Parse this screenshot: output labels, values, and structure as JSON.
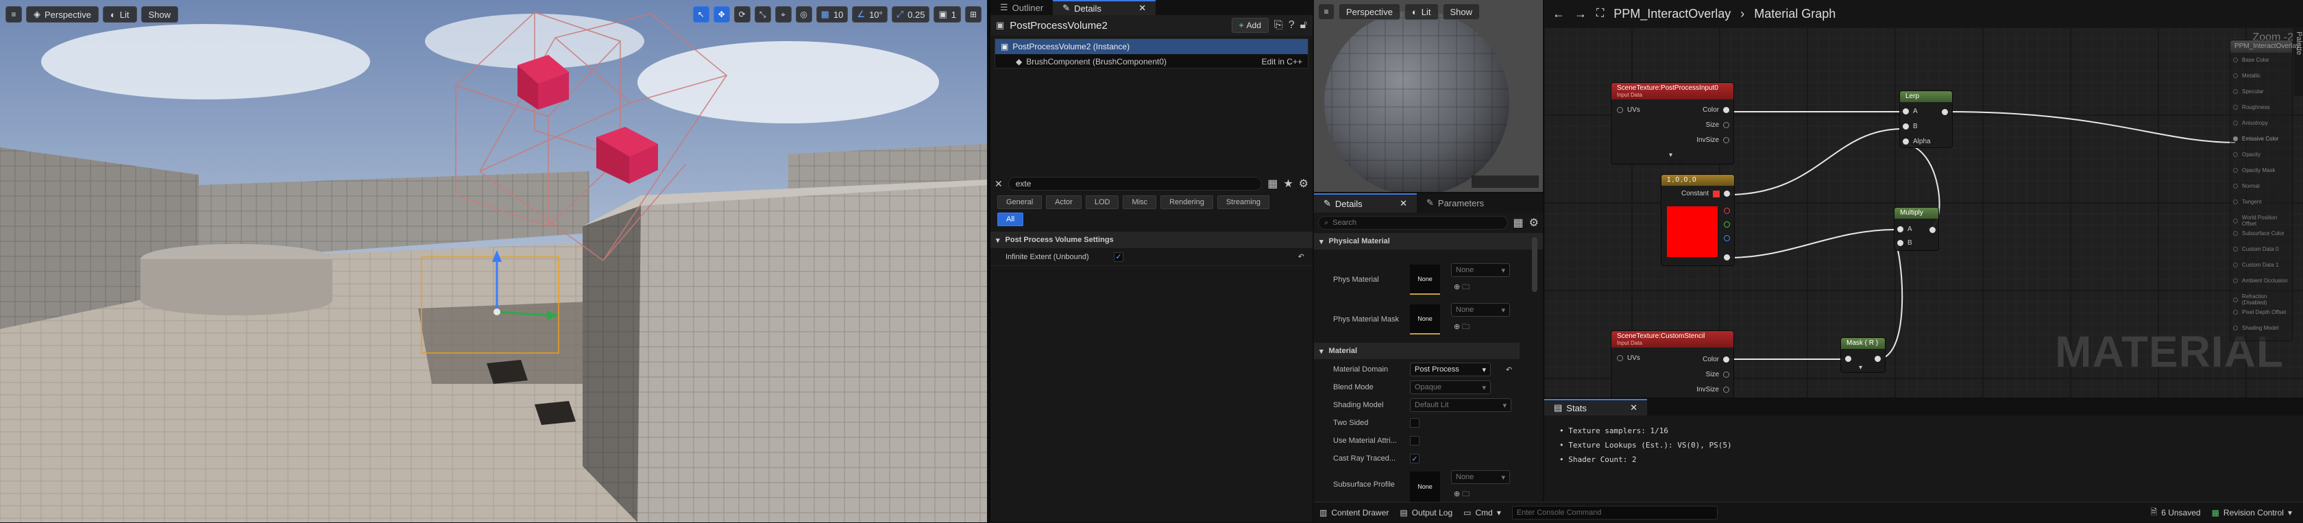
{
  "viewport": {
    "perspective_label": "Perspective",
    "lit_label": "Lit",
    "show_label": "Show",
    "grid_snap_value": "10",
    "rotation_snap_value": "10°",
    "scale_snap_value": "0.25",
    "camera_speed_value": "1"
  },
  "outliner": {
    "tab_outliner": "Outliner",
    "tab_details": "Details",
    "actor_name": "PostProcessVolume2",
    "add_label": "Add",
    "tree": [
      {
        "label": "PostProcessVolume2 (Instance)"
      },
      {
        "label": "BrushComponent (BrushComponent0)",
        "action": "Edit in C++"
      }
    ],
    "search_value": "exte",
    "category_tabs": [
      "General",
      "Actor",
      "LOD",
      "Misc",
      "Rendering",
      "Streaming"
    ],
    "all_tab": "All",
    "section_title": "Post Process Volume Settings",
    "property_label": "Infinite Extent (Unbound)",
    "property_checked": "✓"
  },
  "preview": {
    "perspective_label": "Perspective",
    "lit_label": "Lit",
    "show_label": "Show"
  },
  "mat_details": {
    "tab_details": "Details",
    "tab_parameters": "Parameters",
    "search_placeholder": "Search",
    "section_physical": "Physical Material",
    "phys_material_label": "Phys Material",
    "phys_material_mask_label": "Phys Material Mask",
    "none_label": "None",
    "section_material": "Material",
    "material_domain_label": "Material Domain",
    "material_domain_value": "Post Process",
    "blend_mode_label": "Blend Mode",
    "blend_mode_value": "Opaque",
    "shading_model_label": "Shading Model",
    "shading_model_value": "Default Lit",
    "two_sided_label": "Two Sided",
    "use_material_attr_label": "Use Material Attri...",
    "cast_ray_label": "Cast Ray Traced...",
    "cast_ray_checked": "✓",
    "subsurface_label": "Subsurface Profile"
  },
  "graph": {
    "breadcrumb_asset": "PPM_InteractOverlay",
    "breadcrumb_sep": "›",
    "breadcrumb_graph": "Material Graph",
    "zoom_label": "Zoom -2",
    "palette_label": "Palette",
    "watermark": "MATERIAL",
    "nodes": {
      "scene_texture_1": {
        "title": "SceneTexture:PostProcessInput0",
        "subtitle": "Input Data",
        "pin_uvs": "UVs",
        "pin_color": "Color",
        "pin_size": "Size",
        "pin_invsize": "InvSize"
      },
      "constant": {
        "title": "1,0,0,0",
        "pin_constant": "Constant"
      },
      "lerp": {
        "title": "Lerp",
        "pin_a": "A",
        "pin_b": "B",
        "pin_alpha": "Alpha"
      },
      "multiply": {
        "title": "Multiply",
        "pin_a": "A",
        "pin_b": "B"
      },
      "scene_texture_2": {
        "title": "SceneTexture:CustomStencil",
        "subtitle": "Input Data",
        "pin_uvs": "UVs",
        "pin_color": "Color",
        "pin_size": "Size",
        "pin_invsize": "InvSize"
      },
      "mask": {
        "title": "Mask ( R )"
      },
      "result": {
        "title": "PPM_InteractOverlay",
        "pins": [
          "Base Color",
          "Metallic",
          "Specular",
          "Roughness",
          "Anisotropy",
          "Emissive Color",
          "Opacity",
          "Opacity Mask",
          "Normal",
          "Tangent",
          "World Position Offset",
          "Subsurface Color",
          "Custom Data 0",
          "Custom Data 1",
          "Ambient Occlusion",
          "Refraction (Disabled)",
          "Pixel Depth Offset",
          "Shading Model"
        ],
        "active_pin": "Emissive Color"
      }
    }
  },
  "stats": {
    "tab_label": "Stats",
    "lines": [
      "Texture samplers: 1/16",
      "Texture Lookups (Est.): VS(0), PS(5)",
      "Shader Count: 2"
    ]
  },
  "bottom": {
    "content_drawer": "Content Drawer",
    "output_log": "Output Log",
    "cmd_label": "Cmd",
    "console_placeholder": "Enter Console Command",
    "unsaved": "6 Unsaved",
    "revision_control": "Revision Control"
  },
  "colors": {
    "accent": "#2a6bd8",
    "scene_texture_header": "#9b1c1c",
    "constant_header": "#8b6a20",
    "math_header": "#4c6b3c",
    "result_header": "#5a5a5a",
    "constant_red": "#ff0000"
  }
}
